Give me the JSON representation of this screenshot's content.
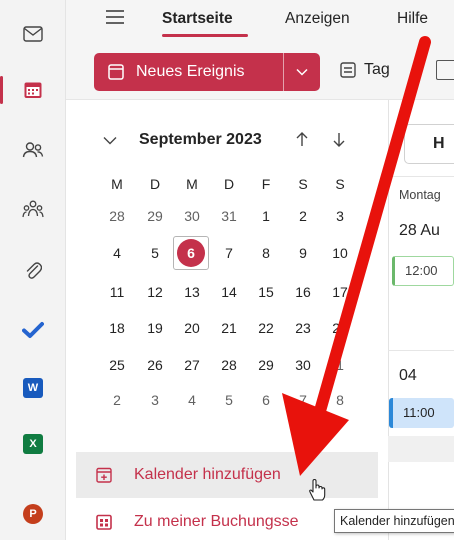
{
  "rail": {
    "items": [
      {
        "icon": "mail-icon"
      },
      {
        "icon": "calendar-icon",
        "active": true
      },
      {
        "icon": "people-icon"
      },
      {
        "icon": "groups-icon"
      },
      {
        "icon": "attachment-icon"
      },
      {
        "icon": "todo-icon"
      },
      {
        "icon": "word-icon",
        "letter": "W"
      },
      {
        "icon": "excel-icon",
        "letter": "X"
      },
      {
        "icon": "powerpoint-icon",
        "letter": "P"
      }
    ]
  },
  "topnav": {
    "tabs": [
      {
        "label": "Startseite",
        "active": true
      },
      {
        "label": "Anzeigen"
      },
      {
        "label": "Hilfe"
      }
    ]
  },
  "ribbon": {
    "new_event_label": "Neues Ereignis",
    "day_view_label": "Tag"
  },
  "mini_calendar": {
    "month_title": "September 2023",
    "weekdays": [
      "M",
      "D",
      "M",
      "D",
      "F",
      "S",
      "S"
    ],
    "weeks": [
      [
        "28",
        "29",
        "30",
        "31",
        "1",
        "2",
        "3"
      ],
      [
        "4",
        "5",
        "6",
        "7",
        "8",
        "9",
        "10"
      ],
      [
        "11",
        "12",
        "13",
        "14",
        "15",
        "16",
        "17"
      ],
      [
        "18",
        "19",
        "20",
        "21",
        "22",
        "23",
        "24"
      ],
      [
        "25",
        "26",
        "27",
        "28",
        "29",
        "30",
        "1"
      ],
      [
        "2",
        "3",
        "4",
        "5",
        "6",
        "7",
        "8"
      ]
    ],
    "today": "6"
  },
  "actions": {
    "add_calendar": "Kalender hinzufügen",
    "booking": "Zu meiner Buchungsse"
  },
  "pane": {
    "today_button": "H",
    "day_header": "Montag",
    "date_a": "28 Au",
    "event_a_time": "12:00",
    "date_b": "04",
    "event_b_time": "11:00"
  },
  "tooltip": {
    "text": "Kalender hinzufügen"
  },
  "colors": {
    "accent": "#c4314b",
    "arrow": "#e8120c",
    "word": "#185abd",
    "excel": "#107c41",
    "powerpoint": "#c43e1c",
    "todo": "#2564cf"
  }
}
